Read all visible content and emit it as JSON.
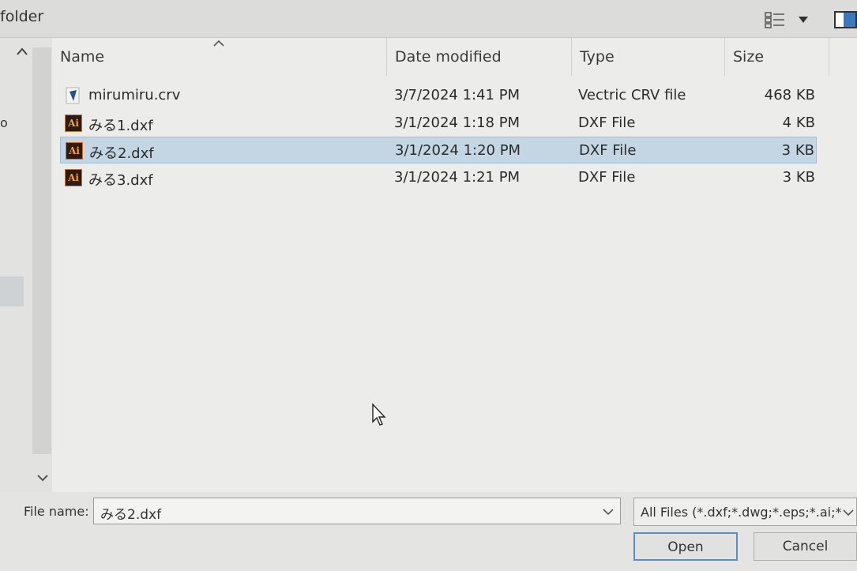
{
  "toolbar": {
    "title": "folder",
    "view_icon": "details-view-icon",
    "view_dropdown_icon": "chevron-down-icon",
    "pane_icon": "preview-pane-icon"
  },
  "nav": {
    "stub_text": "o"
  },
  "columns": {
    "name": "Name",
    "date": "Date modified",
    "type": "Type",
    "size": "Size"
  },
  "files": [
    {
      "icon": "vectric-crv-icon",
      "name": "mirumiru.crv",
      "date": "3/7/2024 1:41 PM",
      "type": "Vectric CRV file",
      "size": "468 KB",
      "selected": false
    },
    {
      "icon": "illustrator-icon",
      "name": "みる1.dxf",
      "date": "3/1/2024 1:18 PM",
      "type": "DXF File",
      "size": "4 KB",
      "selected": false
    },
    {
      "icon": "illustrator-icon",
      "name": "みる2.dxf",
      "date": "3/1/2024 1:20 PM",
      "type": "DXF File",
      "size": "3 KB",
      "selected": true
    },
    {
      "icon": "illustrator-icon",
      "name": "みる3.dxf",
      "date": "3/1/2024 1:21 PM",
      "type": "DXF File",
      "size": "3 KB",
      "selected": false
    }
  ],
  "ai_icon_text": "Ai",
  "footer": {
    "file_name_label": "File name:",
    "file_name_value": "みる2.dxf",
    "filter_value": "All Files (*.dxf;*.dwg;*.eps;*.ai;*",
    "open_label": "Open",
    "cancel_label": "Cancel"
  },
  "colors": {
    "selection": "#c4d6e3",
    "ai_icon_bg": "#2e1a0e",
    "ai_icon_fg": "#f3a03c"
  }
}
